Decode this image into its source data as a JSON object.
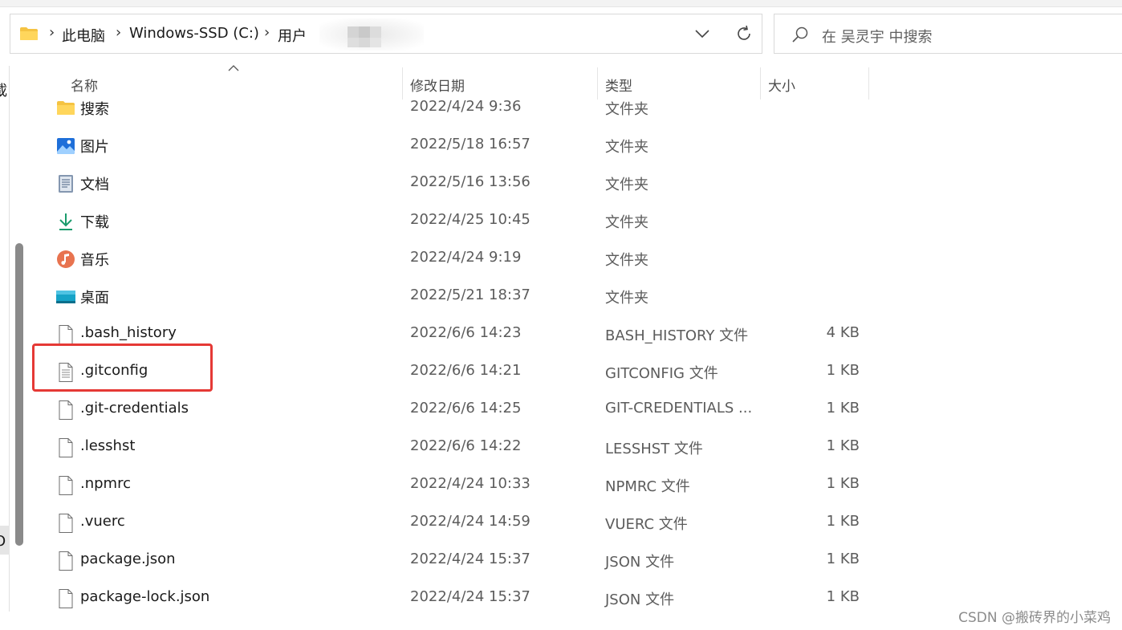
{
  "address_bar": {
    "breadcrumbs": [
      "此电脑",
      "Windows-SSD (C:)",
      "用户"
    ],
    "separator": "›"
  },
  "search": {
    "placeholder": "在 吴灵宇 中搜索"
  },
  "nav_pane": {
    "clipped_label_top": "載",
    "clipped_label_bottom": "O"
  },
  "columns": {
    "name": "名称",
    "date": "修改日期",
    "type": "类型",
    "size": "大小"
  },
  "files": [
    {
      "name": "搜索",
      "date": "2022/4/24 9:36",
      "type": "文件夹",
      "size": "",
      "icon": "folder-icon"
    },
    {
      "name": "图片",
      "date": "2022/5/18 16:57",
      "type": "文件夹",
      "size": "",
      "icon": "pictures-icon"
    },
    {
      "name": "文档",
      "date": "2022/5/16 13:56",
      "type": "文件夹",
      "size": "",
      "icon": "documents-icon"
    },
    {
      "name": "下载",
      "date": "2022/4/25 10:45",
      "type": "文件夹",
      "size": "",
      "icon": "download-icon"
    },
    {
      "name": "音乐",
      "date": "2022/4/24 9:19",
      "type": "文件夹",
      "size": "",
      "icon": "music-icon"
    },
    {
      "name": "桌面",
      "date": "2022/5/21 18:37",
      "type": "文件夹",
      "size": "",
      "icon": "desktop-icon"
    },
    {
      "name": ".bash_history",
      "date": "2022/6/6 14:23",
      "type": "BASH_HISTORY 文件",
      "size": "4 KB",
      "icon": "file-icon"
    },
    {
      "name": ".gitconfig",
      "date": "2022/6/6 14:21",
      "type": "GITCONFIG 文件",
      "size": "1 KB",
      "icon": "text-file-icon"
    },
    {
      "name": ".git-credentials",
      "date": "2022/6/6 14:25",
      "type": "GIT-CREDENTIALS ...",
      "size": "1 KB",
      "icon": "file-icon"
    },
    {
      "name": ".lesshst",
      "date": "2022/6/6 14:22",
      "type": "LESSHST 文件",
      "size": "1 KB",
      "icon": "file-icon"
    },
    {
      "name": ".npmrc",
      "date": "2022/4/24 10:33",
      "type": "NPMRC 文件",
      "size": "1 KB",
      "icon": "file-icon"
    },
    {
      "name": ".vuerc",
      "date": "2022/4/24 14:59",
      "type": "VUERC 文件",
      "size": "1 KB",
      "icon": "file-icon"
    },
    {
      "name": "package.json",
      "date": "2022/4/24 15:37",
      "type": "JSON 文件",
      "size": "1 KB",
      "icon": "file-icon"
    },
    {
      "name": "package-lock.json",
      "date": "2022/4/24 15:37",
      "type": "JSON 文件",
      "size": "1 KB",
      "icon": "file-icon"
    }
  ],
  "annotation": {
    "color": "#e53935"
  },
  "watermark": "CSDN @搬砖界的小菜鸡"
}
